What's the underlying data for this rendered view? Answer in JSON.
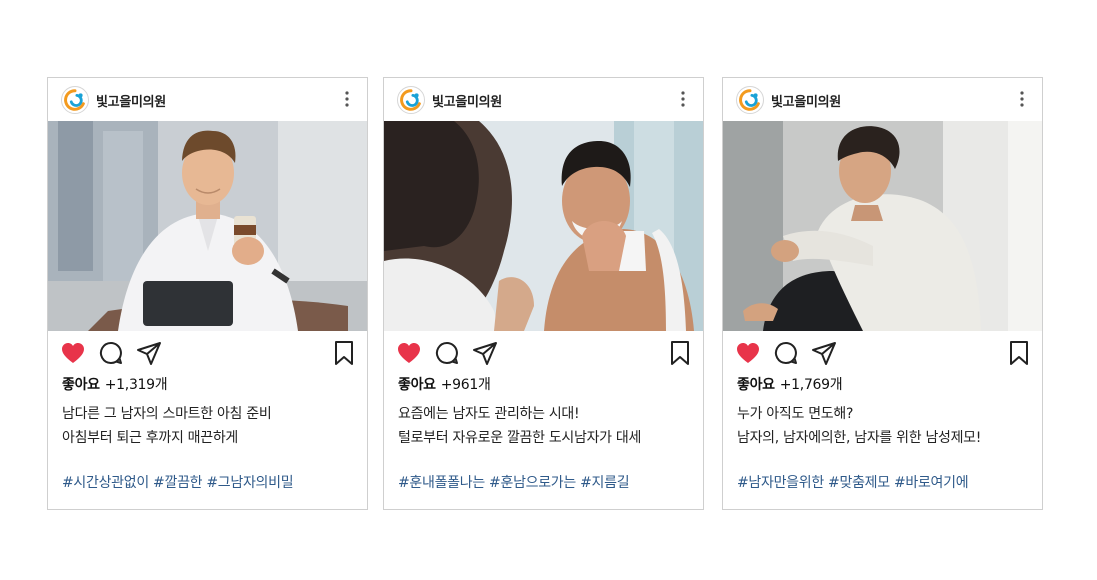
{
  "posts": [
    {
      "account": "빛고을미의원",
      "likes_label": "좋아요",
      "likes_count": "+1,319개",
      "caption_line1": "남다른 그 남자의 스마트한 아침 준비",
      "caption_line2": "아침부터 퇴근 후까지 매끈하게",
      "hashtags": "#시간상관없이 #깔끔한 #그남자의비밀",
      "photo": "man-with-coffee-and-tablet"
    },
    {
      "account": "빛고을미의원",
      "likes_label": "좋아요",
      "likes_count": "+961개",
      "caption_line1": "요즘에는 남자도 관리하는 시대!",
      "caption_line2": "털로부터 자유로운 깔끔한 도시남자가 대세",
      "hashtags": "#훈내폴폴나는 #훈남으로가는 #지름길",
      "photo": "man-shaving-at-mirror"
    },
    {
      "account": "빛고을미의원",
      "likes_label": "좋아요",
      "likes_count": "+1,769개",
      "caption_line1": "누가 아직도 면도해?",
      "caption_line2": "남자의, 남자에의한, 남자를 위한 남성제모!",
      "hashtags": "#남자만을위한 #맞춤제모 #바로여기에",
      "photo": "man-in-white-sweater-sitting"
    }
  ],
  "icons": {
    "like": "heart-icon",
    "comment": "comment-icon",
    "share": "share-icon",
    "save": "bookmark-icon",
    "more": "more-vertical-icon"
  },
  "colors": {
    "heart": "#e8344a",
    "hashtag": "#2f5a8a",
    "logo_orange": "#f39a1e",
    "logo_blue": "#1aa2d6"
  }
}
